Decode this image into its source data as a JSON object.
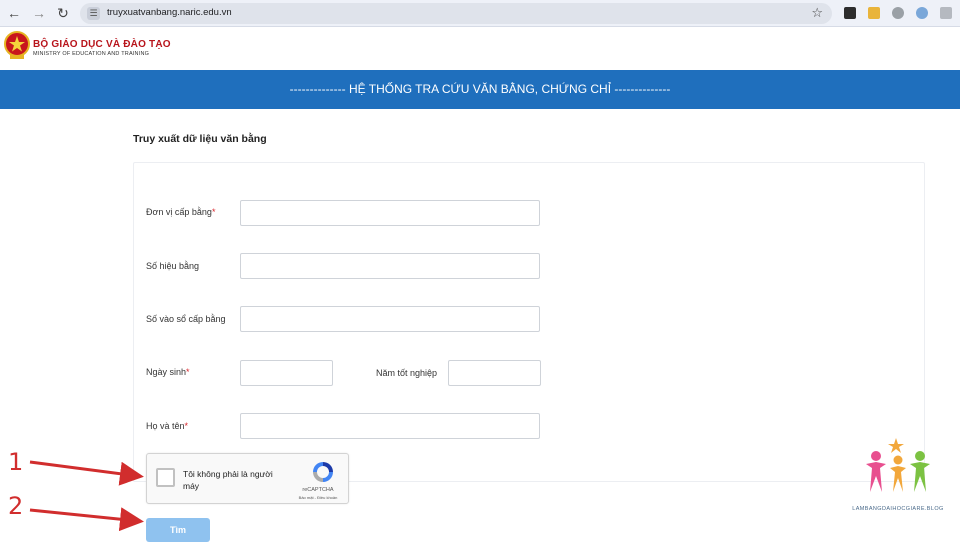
{
  "browser": {
    "url": "truyxuatvanbang.naric.edu.vn",
    "icons": [
      "back-icon",
      "forward-icon",
      "reload-icon",
      "site-info-icon",
      "bookmark-star-icon"
    ]
  },
  "header": {
    "org_name": "BỘ GIÁO DỤC VÀ ĐÀO TẠO",
    "org_subtitle": "MINISTRY OF EDUCATION AND TRAINING",
    "banner_title": "--------------   HỆ THỐNG TRA CỨU VĂN BẰNG, CHỨNG CHỈ   --------------"
  },
  "form": {
    "section_title": "Truy xuất dữ liệu văn bằng",
    "fields": {
      "issuer_label": "Đơn vị cấp bằng",
      "serial_label": "Số hiệu bằng",
      "register_label": "Số vào sổ cấp bằng",
      "dob_label": "Ngày sinh",
      "grad_year_label": "Năm tốt nghiệp",
      "fullname_label": "Họ và tên"
    },
    "required_mark": "*",
    "captcha": {
      "label": "Tôi không phải là người máy",
      "brand": "reCAPTCHA",
      "links": "Bảo mật - Điều khoản"
    },
    "submit_label": "Tìm"
  },
  "annotations": {
    "step1": "1",
    "step2": "2",
    "arrow_color": "#d12d2d"
  },
  "watermark": {
    "text": "LAMBANGDAIHOCGIARE.BLOG"
  },
  "colors": {
    "banner": "#1f6fbd",
    "required": "#d9252b",
    "submit": "#8fc2ef"
  }
}
